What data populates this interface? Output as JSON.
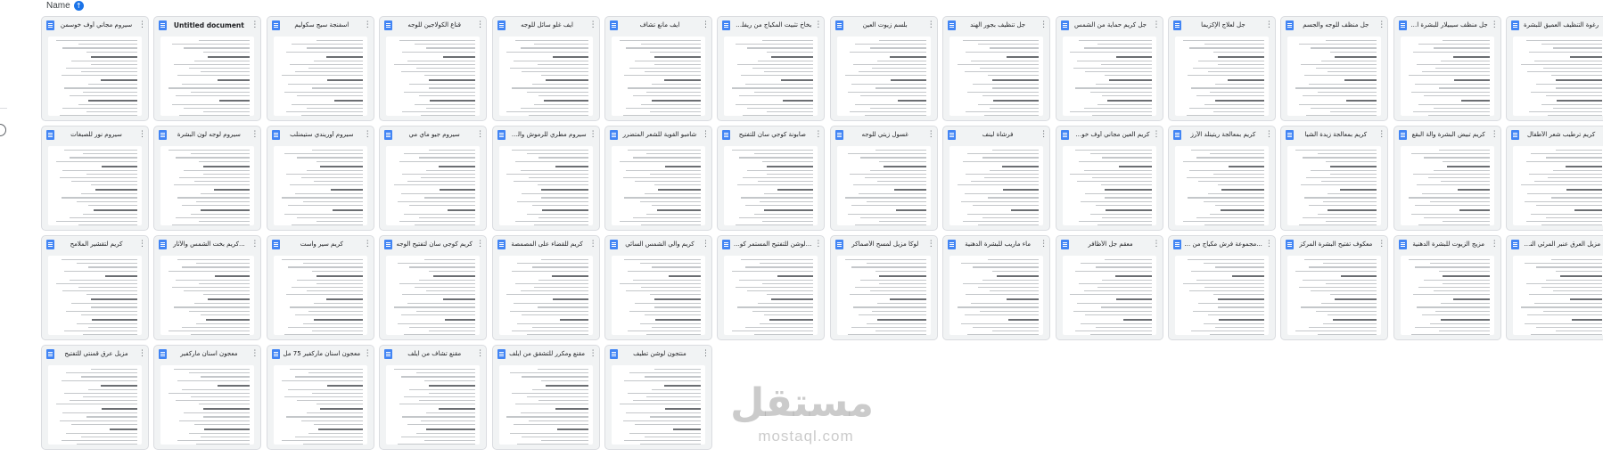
{
  "sort": {
    "label": "Name",
    "arrow": "↑"
  },
  "menu_glyph": "⋮",
  "watermark": {
    "arabic": "مستقل",
    "latin": "mostaql.com"
  },
  "colors": {
    "doc_icon": "#4285f4",
    "sort_arrow": "#1a73e8"
  },
  "documents": [
    {
      "title": "سيروم مجاني أوف خوسمن"
    },
    {
      "title": "Untitled document"
    },
    {
      "title": "اسفنجة سيج سكوليم"
    },
    {
      "title": "قناع الكولاجين للوجه"
    },
    {
      "title": "ايف غلو سائل للوجه"
    },
    {
      "title": "ايف مانع تشاف"
    },
    {
      "title": "بخاخ تثبيت المكياج من ريفلوشن"
    },
    {
      "title": "بلسم زيوت العين"
    },
    {
      "title": "جل تنظيف بجور الهند"
    },
    {
      "title": "جل كريم حماية من الشمس"
    },
    {
      "title": "جل لعلاج الإكزيما"
    },
    {
      "title": "جل منظف للوجه والجسم"
    },
    {
      "title": "جل منظف سيبيلار للبشرة الدهنية"
    },
    {
      "title": "رغوة التنظيف العميق للبشرة"
    },
    {
      "title": "سيروم نور للصبغات"
    },
    {
      "title": "سيروم لوجه لون البشرة"
    },
    {
      "title": "سيروم أوريندي ستيمنلب"
    },
    {
      "title": "سيروم جيو ماي مي"
    },
    {
      "title": "سيروم مطري للرموش والحواجب"
    },
    {
      "title": "شامبو القوية للشعر المتضرر"
    },
    {
      "title": "صابونة كوجي سان للتفتيح"
    },
    {
      "title": "غسول زيتي للوجه"
    },
    {
      "title": "فرشاة لينف"
    },
    {
      "title": "كريم العين مجاني أوف خوسمن"
    },
    {
      "title": "كريم بمعالجة ريتينلد الأرز"
    },
    {
      "title": "كريم بمعالجة زيدة الشيا"
    },
    {
      "title": "كريم تبيض البشرة والة البقع"
    },
    {
      "title": "كريم ترطيب شعر الأطفال"
    },
    {
      "title": "كريم لتقشير الملامح"
    },
    {
      "title": "...كريم بخت الشمس والأثار"
    },
    {
      "title": "كريم سير واست"
    },
    {
      "title": "كريم كوجي سان لتفتيح الوجه"
    },
    {
      "title": "كريم للقضاء على المصمصة"
    },
    {
      "title": "كريم والي الشمس السائي"
    },
    {
      "title": "...لوشن للتفتيح المستمر كوجي"
    },
    {
      "title": "لوكا مزيل لمسح الأصماكر"
    },
    {
      "title": "ماء ماريب للبشرة الدهنية"
    },
    {
      "title": "معقم جل الأظافر"
    },
    {
      "title": "...مجموعة فرش مكياج من ريال"
    },
    {
      "title": "معكوف تفتيح البشرة المركز"
    },
    {
      "title": "مزيج الزيوت للبشرة الدهنية"
    },
    {
      "title": "مزيل العرق عنبر المرئي النساء"
    },
    {
      "title": "مزيل عرق قمنتي للتفتيح"
    },
    {
      "title": "معجون اسنان ماركفير"
    },
    {
      "title": "معجون اسنان ماركفير 75 مل"
    },
    {
      "title": "مقنع تشاف من ايلف"
    },
    {
      "title": "مقنع ومكرر للتشقق من ايلف"
    },
    {
      "title": "منتجون لوشن تطيف"
    }
  ]
}
